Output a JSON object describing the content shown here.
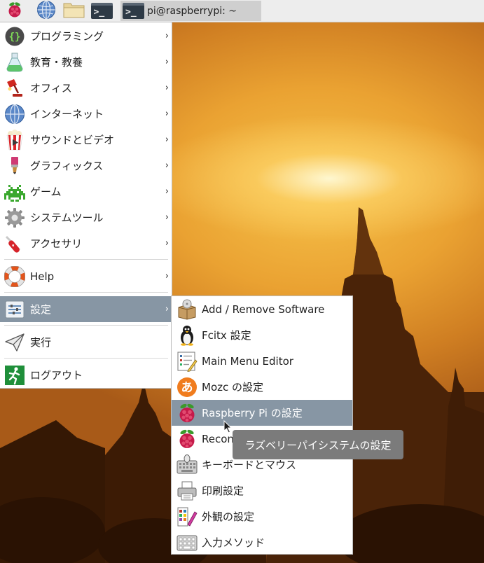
{
  "taskbar": {
    "icons": [
      "raspberry-menu-icon",
      "globe-icon",
      "folder-icon",
      "terminal-icon"
    ],
    "terminal_prompt_glyph": ">_",
    "window_title": "pi@raspberrypi: ~"
  },
  "main_menu": {
    "items": [
      {
        "label": "プログラミング",
        "icon": "braces-icon",
        "arrow": "›"
      },
      {
        "label": "教育・教養",
        "icon": "flask-icon",
        "arrow": "›"
      },
      {
        "label": "オフィス",
        "icon": "desk-lamp-icon",
        "arrow": "›"
      },
      {
        "label": "インターネット",
        "icon": "globe-icon",
        "arrow": "›"
      },
      {
        "label": "サウンドとビデオ",
        "icon": "popcorn-icon",
        "arrow": "›"
      },
      {
        "label": "グラフィックス",
        "icon": "paintbrush-icon",
        "arrow": "›"
      },
      {
        "label": "ゲーム",
        "icon": "space-invader-icon",
        "arrow": "›"
      },
      {
        "label": "システムツール",
        "icon": "gear-icon",
        "arrow": "›"
      },
      {
        "label": "アクセサリ",
        "icon": "pocket-knife-icon",
        "arrow": "›"
      },
      {
        "label": "Help",
        "icon": "lifebuoy-icon",
        "arrow": "›"
      },
      {
        "label": "設定",
        "icon": "settings-sliders-icon",
        "arrow": "›",
        "active": true
      },
      {
        "label": "実行",
        "icon": "paper-plane-icon"
      },
      {
        "label": "ログアウト",
        "icon": "exit-runner-icon"
      }
    ]
  },
  "settings_submenu": {
    "items": [
      {
        "label": "Add / Remove Software",
        "icon": "package-icon"
      },
      {
        "label": "Fcitx 設定",
        "icon": "penguin-icon"
      },
      {
        "label": "Main Menu Editor",
        "icon": "menu-editor-icon"
      },
      {
        "label": "Mozc の設定",
        "icon": "mozc-icon"
      },
      {
        "label": "Raspberry Pi の設定",
        "icon": "raspberry-icon",
        "active": true
      },
      {
        "label": "Recon",
        "icon": "raspberry-icon"
      },
      {
        "label": "キーボードとマウス",
        "icon": "keyboard-mouse-icon"
      },
      {
        "label": "印刷設定",
        "icon": "printer-icon"
      },
      {
        "label": "外観の設定",
        "icon": "palette-icon"
      },
      {
        "label": "入力メソッド",
        "icon": "input-method-icon"
      }
    ]
  },
  "tooltip": {
    "text": "ラズベリーパイシステムの設定"
  },
  "colors": {
    "highlight": "#8796a4",
    "taskbar": "#ededed",
    "tooltip": "#7b7b7b"
  }
}
